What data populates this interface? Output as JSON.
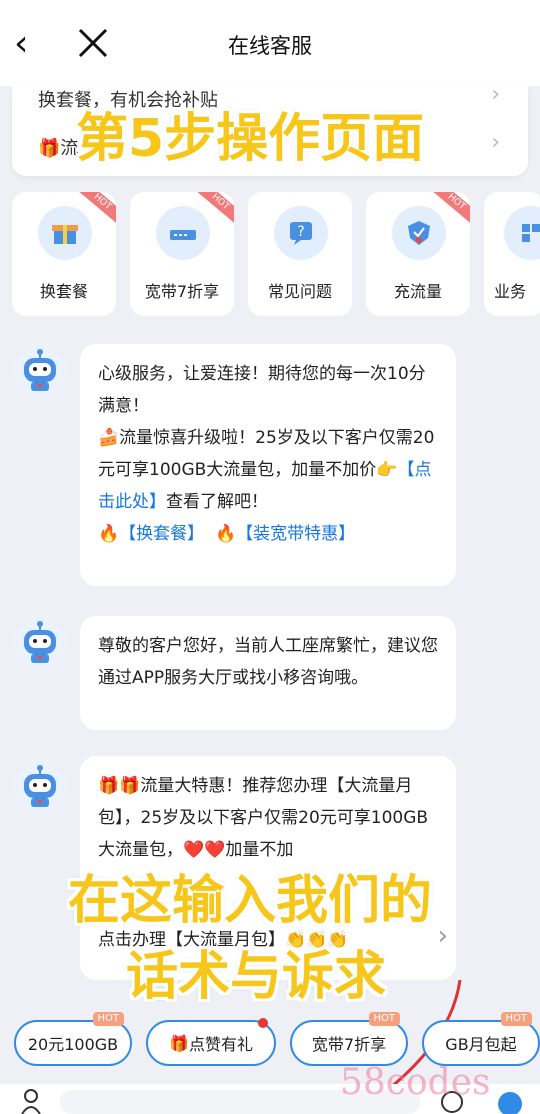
{
  "header": {
    "title": "在线客服",
    "back": "‹"
  },
  "notice": {
    "line1": "换套餐，有机会抢补贴",
    "line2": "流"
  },
  "quick_entries": [
    {
      "label": "换套餐",
      "hot": "HOT"
    },
    {
      "label": "宽带7折享",
      "hot": "HOT"
    },
    {
      "label": "常见问题",
      "hot": ""
    },
    {
      "label": "充流量",
      "hot": "HOT"
    },
    {
      "label": "业务",
      "hot": ""
    }
  ],
  "messages": [
    {
      "text1": "心级服务，让爱连接！期待您的每一次10分满意！",
      "text2": "流量惊喜升级啦！25岁及以下客户仅需20元可享100GB大流量包，加量不加价",
      "link1": "【点击此处】",
      "text3": "查看了解吧！",
      "link2": "【换套餐】",
      "link3": "【装宽带特惠】"
    },
    {
      "text": "尊敬的客户您好，当前人工座席繁忙，建议您通过APP服务大厅或找小移咨询哦。"
    },
    {
      "text1": "流量大特惠！推荐您办理【大流量月包】，25岁及以下客户仅需20元可享100GB大流量包，",
      "text2": "加量不加",
      "text3": "点击办理【大流量月包】"
    }
  ],
  "overlays": {
    "step": "第5步操作页面",
    "line1": "在这输入我们的",
    "line2": "话术与诉求"
  },
  "chips": [
    {
      "label": "20元100GB",
      "tag": "HOT"
    },
    {
      "label": "点赞有礼",
      "tag": ""
    },
    {
      "label": "宽带7折享",
      "tag": "HOT"
    },
    {
      "label": "GB月包起",
      "tag": "HOT"
    }
  ],
  "watermark": "58codes",
  "colors": {
    "accent": "#2f8be6",
    "overlay": "#f7c61a",
    "link": "#1678e0"
  }
}
